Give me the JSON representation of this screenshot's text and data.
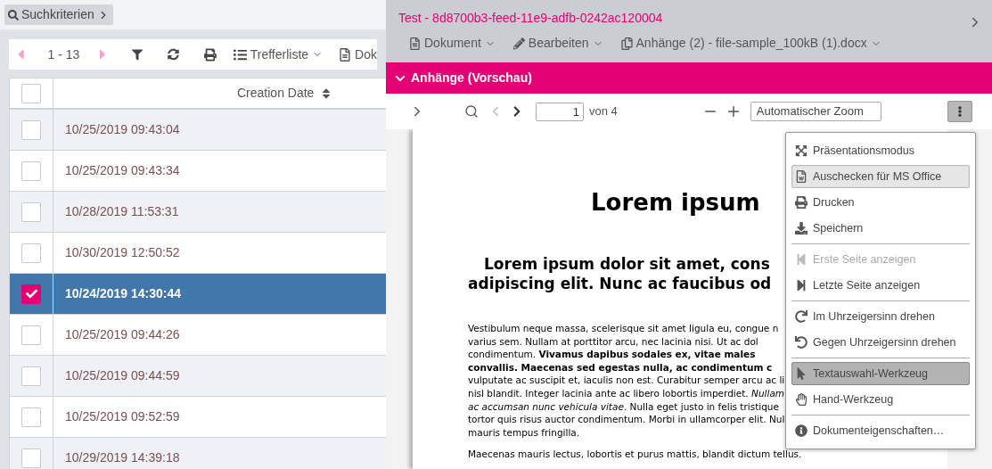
{
  "search_button": {
    "label": "Suchkriterien"
  },
  "toolbar": {
    "range": "1 - 13",
    "result_list": "Trefferliste",
    "document": "Dok"
  },
  "table": {
    "header_checked": false,
    "column": "Creation Date",
    "rows": [
      {
        "date": "10/25/2019 09:43:04",
        "selected": false
      },
      {
        "date": "10/25/2019 09:43:34",
        "selected": false
      },
      {
        "date": "10/28/2019 11:53:31",
        "selected": false
      },
      {
        "date": "10/30/2019 12:50:52",
        "selected": false
      },
      {
        "date": "10/24/2019 14:30:44",
        "selected": true
      },
      {
        "date": "10/25/2019 09:44:26",
        "selected": false
      },
      {
        "date": "10/25/2019 09:44:59",
        "selected": false
      },
      {
        "date": "10/25/2019 09:52:59",
        "selected": false
      },
      {
        "date": "10/29/2019 14:39:18",
        "selected": false
      }
    ]
  },
  "detail": {
    "title": "Test - 8d8700b3-feed-11e9-adfb-0242ac120004",
    "menus": [
      "Dokument",
      "Bearbeiten",
      "Anhänge (2) - file-sample_100kB (1).docx"
    ],
    "section": {
      "title": "Anhänge (Vorschau)",
      "expanded": true
    }
  },
  "viewer": {
    "page": "1",
    "page_count": "von 4",
    "zoom": "Automatischer Zoom",
    "document": {
      "title": "Lorem ipsum",
      "subtitle": [
        "Lorem ipsum dolor sit amet, cons",
        "adipiscing elit. Nunc ac faucibus od"
      ],
      "paragraph": [
        "Vestibulum neque massa, scelerisque sit amet ligula eu, congue n",
        "varius sem. Nullam at porttitor arcu, nec lacinia nisi. Ut ac dol",
        "condimentum. **Vivamus dapibus sodales ex, vitae males**",
        "**convallis. Maecenas sed egestas nulla, ac condimentum c**",
        "vulputate ac suscipit et, iaculis non est. Curabitur semper arcu ac li",
        "nisl blandit. Integer lacinia ante ac libero lobortis imperdiet. *Nullam*",
        "*ac accumsan nunc vehicula vitae*. Nulla eget justo in felis tristique",
        "tortor quis risus auctor condimentum. Morbi in ullamcorper elit. Nul",
        "mauris tempus fringilla."
      ],
      "paragraph_2": "Maecenas mauris lectus, lobortis et purus mattis, blandit dictum tellus."
    }
  },
  "menu": [
    {
      "kind": "item",
      "label": "Präsentationsmodus",
      "disabled": false,
      "selected": false,
      "hovered": false
    },
    {
      "kind": "item",
      "label": "Auschecken für MS Office",
      "disabled": false,
      "selected": false,
      "hovered": true
    },
    {
      "kind": "item",
      "label": "Drucken",
      "disabled": false,
      "selected": false,
      "hovered": false
    },
    {
      "kind": "item",
      "label": "Speichern",
      "disabled": false,
      "selected": false,
      "hovered": false
    },
    {
      "kind": "separator"
    },
    {
      "kind": "item",
      "label": "Erste Seite anzeigen",
      "disabled": true,
      "selected": false,
      "hovered": false
    },
    {
      "kind": "item",
      "label": "Letzte Seite anzeigen",
      "disabled": false,
      "selected": false,
      "hovered": false
    },
    {
      "kind": "separator"
    },
    {
      "kind": "item",
      "label": "Im Uhrzeigersinn drehen",
      "disabled": false,
      "selected": false,
      "hovered": false
    },
    {
      "kind": "item",
      "label": "Gegen Uhrzeigersinn drehen",
      "disabled": false,
      "selected": false,
      "hovered": false
    },
    {
      "kind": "separator"
    },
    {
      "kind": "item",
      "label": "Textauswahl-Werkzeug",
      "disabled": false,
      "selected": true,
      "hovered": false
    },
    {
      "kind": "item",
      "label": "Hand-Werkzeug",
      "disabled": false,
      "selected": false,
      "hovered": false
    },
    {
      "kind": "separator"
    },
    {
      "kind": "item",
      "label": "Dokumenteigenschaften…",
      "disabled": false,
      "selected": false,
      "hovered": false
    }
  ]
}
